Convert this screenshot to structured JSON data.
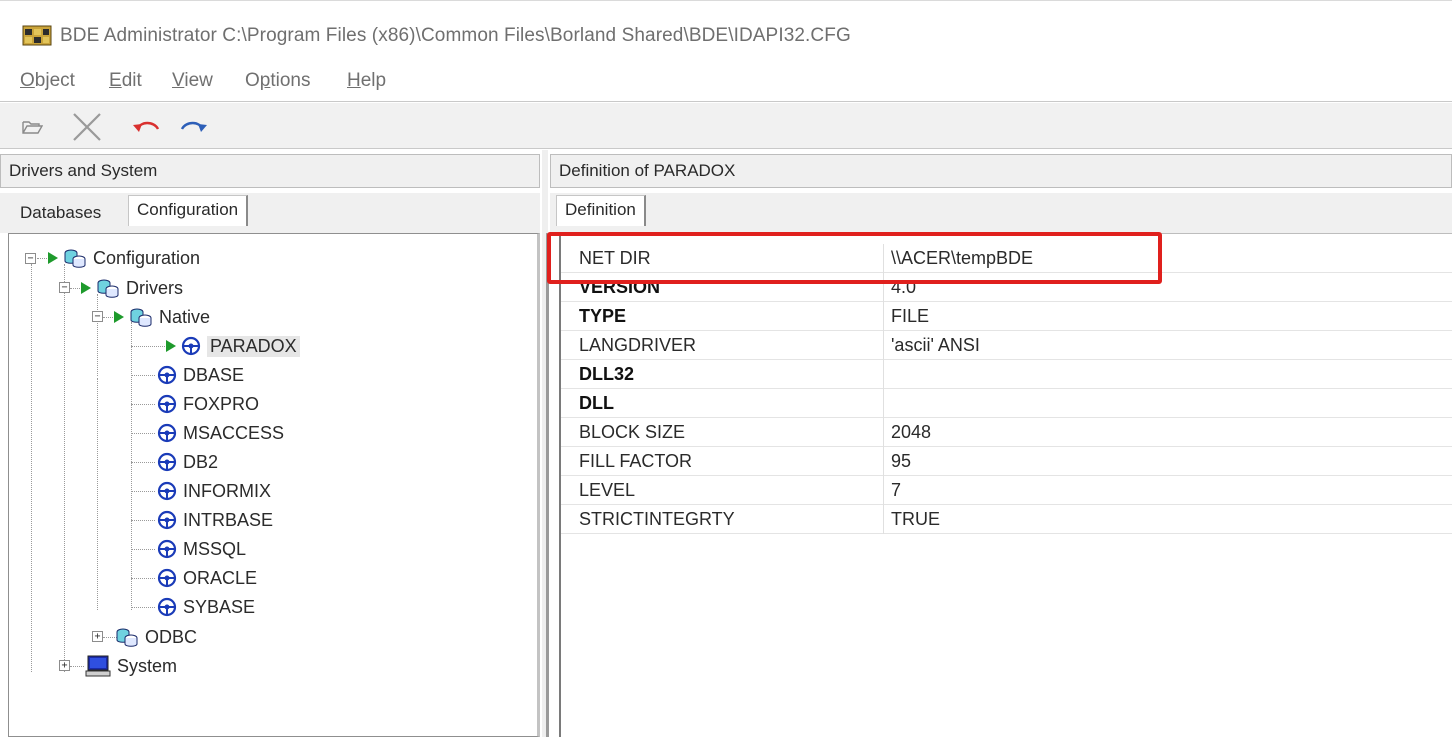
{
  "window": {
    "title": "BDE Administrator  C:\\Program Files (x86)\\Common Files\\Borland Shared\\BDE\\IDAPI32.CFG",
    "app_icon": "bde-database-icon"
  },
  "menu": {
    "items": [
      {
        "label": "Object",
        "accel": "O",
        "rest": "bject"
      },
      {
        "label": "Edit",
        "accel": "E",
        "rest": "dit"
      },
      {
        "label": "View",
        "accel": "V",
        "rest": "iew"
      },
      {
        "label": "Options",
        "accel": "p",
        "pre": "O",
        "rest": "tions"
      },
      {
        "label": "Help",
        "accel": "H",
        "rest": "elp"
      }
    ]
  },
  "toolbar": {
    "buttons": [
      "open-folder-icon",
      "delete-x-icon",
      "undo-icon",
      "redo-icon"
    ],
    "undo_color": "#d9302f",
    "redo_color": "#2d5fb8"
  },
  "left_pane": {
    "header": "Drivers and System",
    "tabs": [
      {
        "label": "Databases",
        "active": false
      },
      {
        "label": "Configuration",
        "active": true
      }
    ],
    "tree": [
      {
        "label": "Configuration",
        "expander": "−",
        "arrow": true,
        "icon": "database-group-icon"
      },
      {
        "label": "Drivers",
        "expander": "−",
        "arrow": true,
        "icon": "database-group-icon"
      },
      {
        "label": "Native",
        "expander": "−",
        "arrow": true,
        "icon": "database-group-icon"
      },
      {
        "label": "PARADOX",
        "arrow": true,
        "icon": "driver-wheel-icon",
        "selected": true
      },
      {
        "label": "DBASE",
        "icon": "driver-wheel-icon"
      },
      {
        "label": "FOXPRO",
        "icon": "driver-wheel-icon"
      },
      {
        "label": "MSACCESS",
        "icon": "driver-wheel-icon"
      },
      {
        "label": "DB2",
        "icon": "driver-wheel-icon"
      },
      {
        "label": "INFORMIX",
        "icon": "driver-wheel-icon"
      },
      {
        "label": "INTRBASE",
        "icon": "driver-wheel-icon"
      },
      {
        "label": "MSSQL",
        "icon": "driver-wheel-icon"
      },
      {
        "label": "ORACLE",
        "icon": "driver-wheel-icon"
      },
      {
        "label": "SYBASE",
        "icon": "driver-wheel-icon"
      },
      {
        "label": "ODBC",
        "expander": "+",
        "icon": "database-group-icon"
      },
      {
        "label": "System",
        "expander": "+",
        "icon": "computer-icon"
      }
    ]
  },
  "right_pane": {
    "header": "Definition of PARADOX",
    "tabs": [
      {
        "label": "Definition",
        "active": true
      }
    ],
    "properties": [
      {
        "name": "NET DIR",
        "value": "\\\\ACER\\tempBDE",
        "bold": false
      },
      {
        "name": "VERSION",
        "value": "4.0",
        "bold": true
      },
      {
        "name": "TYPE",
        "value": "FILE",
        "bold": true
      },
      {
        "name": "LANGDRIVER",
        "value": "'ascii' ANSI",
        "bold": false
      },
      {
        "name": "DLL32",
        "value": "",
        "bold": true
      },
      {
        "name": "DLL",
        "value": "",
        "bold": true
      },
      {
        "name": "BLOCK SIZE",
        "value": "2048",
        "bold": false
      },
      {
        "name": "FILL FACTOR",
        "value": "95",
        "bold": false
      },
      {
        "name": "LEVEL",
        "value": "7",
        "bold": false
      },
      {
        "name": "STRICTINTEGRTY",
        "value": "TRUE",
        "bold": false
      }
    ],
    "highlight_color": "#e0201d"
  }
}
